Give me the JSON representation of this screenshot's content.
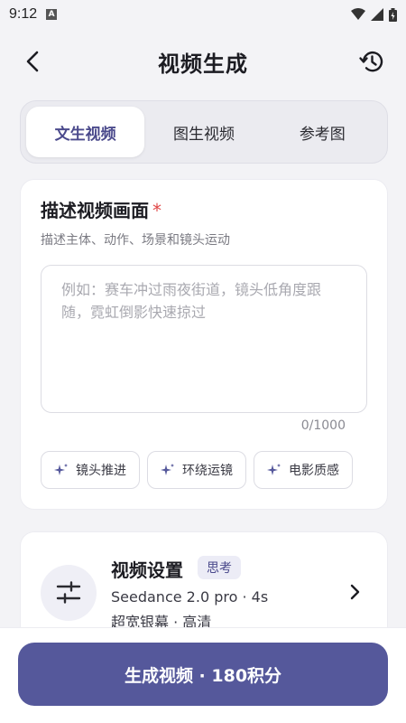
{
  "status_bar": {
    "time": "9:12",
    "notification_letter": "A"
  },
  "header": {
    "title": "视频生成"
  },
  "tabs": [
    {
      "label": "文生视频",
      "active": true
    },
    {
      "label": "图生视频",
      "active": false
    },
    {
      "label": "参考图",
      "active": false
    }
  ],
  "description": {
    "title": "描述视频画面",
    "required_mark": "*",
    "subtitle": "描述主体、动作、场景和镜头运动",
    "placeholder": "例如：赛车冲过雨夜街道，镜头低角度跟随，霓虹倒影快速掠过",
    "value": "",
    "char_count": "0/1000",
    "suggestions": [
      {
        "label": "镜头推进",
        "icon": "sparkle-icon"
      },
      {
        "label": "环绕运镜",
        "icon": "sparkle-icon"
      },
      {
        "label": "电影质感",
        "icon": "sparkle-icon"
      }
    ]
  },
  "settings": {
    "title": "视频设置",
    "badge": "思考",
    "model_line": "Seedance 2.0 pro · 4s",
    "detail_line": "超宽银幕 · 高清",
    "icon": "sliders-icon"
  },
  "generate_button": {
    "label": "生成视频 · 180积分"
  },
  "colors": {
    "accent": "#55589b",
    "accent_text": "#4b4a8c",
    "required": "#e04848"
  }
}
